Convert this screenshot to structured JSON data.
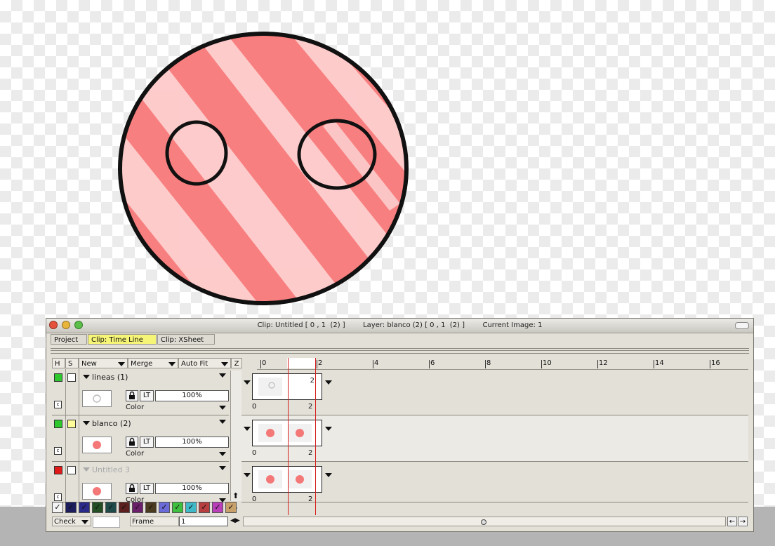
{
  "window": {
    "title": "Clip: Untitled [ 0 , 1  (2) ]        Layer: blanco (2) [ 0 , 1  (2) ]        Current Image: 1"
  },
  "tabs": [
    {
      "label": "Project",
      "active": false
    },
    {
      "label": "Clip: Time Line",
      "active": true
    },
    {
      "label": "Clip: XSheet",
      "active": false
    }
  ],
  "header": {
    "h": "H",
    "s": "S",
    "new_label": "New",
    "merge_label": "Merge",
    "autofit_label": "Auto Fit",
    "z": "Z"
  },
  "layers": [
    {
      "name": "lineas (1)",
      "hide_color": "#2ec72e",
      "select_color": "#ffffff",
      "disabled": false,
      "lock_icon": "lock-icon",
      "lt": "LT",
      "opacity": "100%",
      "mode": "Color",
      "c": "c",
      "start": "0",
      "end": "2",
      "clip_end": "2"
    },
    {
      "name": "blanco (2)",
      "hide_color": "#2ec72e",
      "select_color": "#fdfd9a",
      "disabled": false,
      "lock_icon": "lock-icon",
      "lt": "LT",
      "opacity": "100%",
      "mode": "Color",
      "c": "c",
      "start": "0",
      "end": "2",
      "clip_end": ""
    },
    {
      "name": "Untitled 3",
      "hide_color": "#e01919",
      "select_color": "#ffffff",
      "disabled": true,
      "lock_icon": "lock-icon",
      "lt": "LT",
      "opacity": "100%",
      "mode": "Color",
      "c": "c",
      "start": "0",
      "end": "2",
      "clip_end": ""
    }
  ],
  "ruler": [
    "0",
    "2",
    "4",
    "6",
    "8",
    "10",
    "12",
    "14",
    "16"
  ],
  "swatches": [
    "#1d1d5e",
    "#2a2a8a",
    "#234d23",
    "#1f4a4a",
    "#5c1f1f",
    "#6a1f6a",
    "#4a3a1f",
    "#6a6ad8",
    "#3fbf3f",
    "#3fb8c8",
    "#b83f3f",
    "#b83fb8",
    "#c8a06a"
  ],
  "bottom": {
    "check_label": "Check",
    "frame_label": "Frame",
    "frame_value": "1"
  },
  "colors": {
    "fill": "#f47878",
    "stroke": "#111111",
    "active_tab": "#f7f577",
    "playhead": "#d71f1f"
  }
}
